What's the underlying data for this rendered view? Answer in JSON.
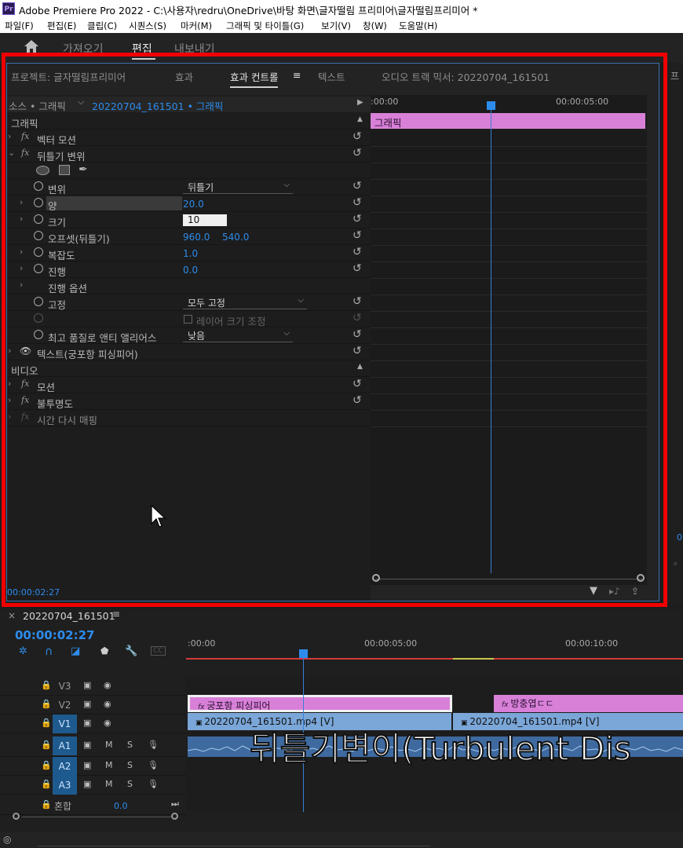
{
  "window": {
    "app_icon": "Pr",
    "title": "Adobe Premiere Pro 2022 - C:\\사용자\\redru\\OneDrive\\바탕 화면\\글자떨림 프리미어\\글자떨림프리미어 *"
  },
  "menu": [
    "파일(F)",
    "편집(E)",
    "클립(C)",
    "시퀀스(S)",
    "마커(M)",
    "그래픽 및 타이틀(G)",
    "보기(V)",
    "창(W)",
    "도움말(H)"
  ],
  "workspaces": [
    "가져오기",
    "편집",
    "내보내기"
  ],
  "panel_tabs": [
    {
      "label": "프로젝트: 글자떨림프리미어"
    },
    {
      "label": "효과"
    },
    {
      "label": "효과 컨트롤"
    },
    {
      "label": "텍스트"
    },
    {
      "label": "오디오 트랙 믹서: 20220704_161501"
    }
  ],
  "panel_tab_menu_glyph": "≡",
  "source": {
    "label": "소스 • 그래픽",
    "clip": "20220704_161501 • 그래픽"
  },
  "mini_timeline": {
    "start": ":00:00",
    "mark": "00:00:05:00",
    "clip_label": "그래픽"
  },
  "sections": {
    "graphic": "그래픽",
    "video": "비디오"
  },
  "effects": {
    "vector_motion": "벡터 모션",
    "turbulent": "뒤틀기 변위",
    "displacement_label": "변위",
    "displacement_value": "뒤틀기",
    "amount_label": "양",
    "amount_value": "20.0",
    "size_label": "크기",
    "size_value": "10",
    "offset_label": "오프셋(뒤틀기)",
    "offset_x": "960.0",
    "offset_y": "540.0",
    "complexity_label": "복잡도",
    "complexity_value": "1.0",
    "evolution_label": "진행",
    "evolution_value": "0.0",
    "evolution_options": "진행 옵션",
    "pinning_label": "고정",
    "pinning_value": "모두 고정",
    "resize_layer": "레이어 크기 조정",
    "antialias_label": "최고 품질로 앤티 앨리어스",
    "antialias_value": "낮음",
    "text_layer": "텍스트(궁포항 피싱피어)",
    "motion": "모션",
    "opacity": "불투명도",
    "time_remap": "시간 다시 매핑"
  },
  "panel_timecode": "00:00:02:27",
  "sequence": {
    "name": "20220704_161501",
    "close": "×",
    "menu_glyph": "≡",
    "timecode": "00:00:02:27",
    "ruler": [
      ":00:00",
      "00:00:05:00",
      "00:00:10:00"
    ],
    "tracks": [
      {
        "name": "V3",
        "type": "video"
      },
      {
        "name": "V2",
        "type": "video"
      },
      {
        "name": "V1",
        "type": "video"
      },
      {
        "name": "A1",
        "type": "audio"
      },
      {
        "name": "A2",
        "type": "audio"
      },
      {
        "name": "A3",
        "type": "audio"
      }
    ],
    "mix_label": "혼합",
    "mix_value": "0.0",
    "clips": {
      "v2a": "궁포항 피싱피어",
      "v2b": "방충엽ㄷㄷ",
      "v1a": "20220704_161501.mp4 [V]",
      "v1b": "20220704_161501.mp4 [V]"
    }
  },
  "overlay_caption": "뒤틀기변이(Turbulent Dis",
  "colors": {
    "accent": "#2d8ceb",
    "highlight_frame": "#f00000",
    "graphic_clip": "#d880d8",
    "video_clip": "#7aa6d8"
  }
}
